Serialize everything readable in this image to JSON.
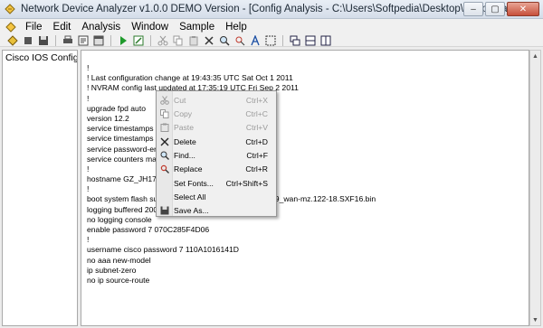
{
  "window": {
    "title": "Network Device Analyzer v1.0.0 DEMO Version - [Config Analysis - C:\\Users\\Softpedia\\Desktop\\Softpedia.txt]",
    "minimize": "–",
    "maximize": "▢",
    "close": "✕"
  },
  "menubar": {
    "items": [
      "File",
      "Edit",
      "Analysis",
      "Window",
      "Sample",
      "Help"
    ]
  },
  "toolbar": {
    "icons": [
      "new-icon",
      "stop-icon",
      "save-icon",
      "print-icon",
      "print-preview-icon",
      "properties-icon",
      "run-icon",
      "export-icon",
      "cut-icon",
      "copy-icon",
      "paste-icon",
      "delete-icon",
      "find-icon",
      "replace-icon",
      "font-icon",
      "select-all-icon",
      "cascade-icon",
      "tile-horizontal-icon",
      "tile-vertical-icon"
    ]
  },
  "tree": {
    "items": [
      "Cisco IOS Configuration"
    ]
  },
  "editor": {
    "lines": [
      "!",
      "! Last configuration change at 19:43:35 UTC Sat Oct 1 2011",
      "! NVRAM config last updated at 17:35:19 UTC Fri Sep 2 2011",
      "!",
      "upgrade fpd auto",
      "version 12.2",
      "service timestamps debug datetime msec",
      "service timestamps log datetime msec",
      "service password-encryption",
      "service counters max age 10",
      "!",
      "hostname GZ_JH17F_C",
      "!",
      "boot system flash sup-bootdisk:s72033-adventerprisek9_wan-mz.122-18.SXF16.bin",
      "logging buffered 20000 debugging",
      "no logging console",
      "enable password 7 070C285F4D06",
      "!",
      "username cisco password 7 110A1016141D",
      "no aaa new-model",
      "ip subnet-zero",
      "no ip source-route"
    ]
  },
  "context_menu": {
    "items": [
      {
        "label": "Cut",
        "shortcut": "Ctrl+X",
        "icon": "cut-icon"
      },
      {
        "label": "Copy",
        "shortcut": "Ctrl+C",
        "icon": "copy-icon"
      },
      {
        "label": "Paste",
        "shortcut": "Ctrl+V",
        "icon": "paste-icon"
      },
      {
        "label": "Delete",
        "shortcut": "Ctrl+D",
        "icon": "delete-icon"
      },
      {
        "label": "Find...",
        "shortcut": "Ctrl+F",
        "icon": "find-icon"
      },
      {
        "label": "Replace",
        "shortcut": "Ctrl+R",
        "icon": "replace-icon"
      },
      {
        "label": "Set Fonts...",
        "shortcut": "Ctrl+Shift+S",
        "icon": ""
      },
      {
        "label": "Select All",
        "shortcut": "",
        "icon": ""
      },
      {
        "label": "Save As...",
        "shortcut": "",
        "icon": "save-icon"
      }
    ],
    "disabled_color": "#9a9a9a"
  }
}
